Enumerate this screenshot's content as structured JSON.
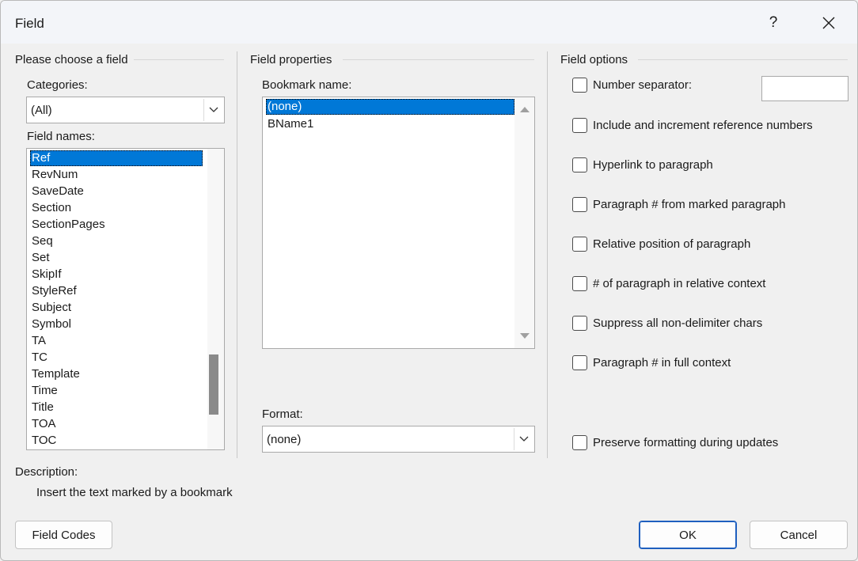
{
  "window": {
    "title": "Field",
    "help_glyph": "?",
    "close_glyph": "✕"
  },
  "choose": {
    "section_title": "Please choose a field",
    "categories_label": "Categories:",
    "categories_value": "(All)",
    "field_names_label": "Field names:",
    "field_names": [
      "Ref",
      "RevNum",
      "SaveDate",
      "Section",
      "SectionPages",
      "Seq",
      "Set",
      "SkipIf",
      "StyleRef",
      "Subject",
      "Symbol",
      "TA",
      "TC",
      "Template",
      "Time",
      "Title",
      "TOA",
      "TOC"
    ],
    "selected": "Ref"
  },
  "properties": {
    "section_title": "Field properties",
    "bookmark_label": "Bookmark name:",
    "bookmarks": [
      "(none)",
      "BName1"
    ],
    "selected": "(none)",
    "format_label": "Format:",
    "format_value": "(none)"
  },
  "options": {
    "section_title": "Field options",
    "items": [
      "Number separator:",
      "Include and increment reference numbers",
      "Hyperlink to paragraph",
      "Paragraph # from marked paragraph",
      "Relative position of paragraph",
      "# of paragraph in relative context",
      "Suppress all non-delimiter chars",
      "Paragraph # in full context"
    ],
    "preserve": "Preserve formatting during updates",
    "separator_value": ""
  },
  "description": {
    "label": "Description:",
    "text": "Insert the text marked by a bookmark"
  },
  "buttons": {
    "field_codes": "Field Codes",
    "ok": "OK",
    "cancel": "Cancel"
  },
  "colors": {
    "selection": "#0078d7",
    "primary_border": "#1e5fbf"
  }
}
